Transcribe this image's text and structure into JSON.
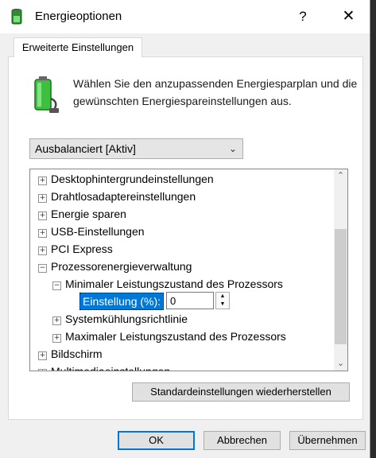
{
  "window": {
    "title": "Energieoptionen",
    "help_glyph": "?",
    "close_glyph": "✕"
  },
  "tab": {
    "label": "Erweiterte Einstellungen"
  },
  "description": "Wählen Sie den anzupassenden Energiesparplan und die gewünschten Energiespareinstellungen aus.",
  "plan_select": {
    "value": "Ausbalanciert [Aktiv]"
  },
  "tree": {
    "items": [
      {
        "label": "Desktophintergrundeinstellungen",
        "expander": "+"
      },
      {
        "label": "Drahtlosadaptereinstellungen",
        "expander": "+"
      },
      {
        "label": "Energie sparen",
        "expander": "+"
      },
      {
        "label": "USB-Einstellungen",
        "expander": "+"
      },
      {
        "label": "PCI Express",
        "expander": "+"
      },
      {
        "label": "Prozessorenergieverwaltung",
        "expander": "−"
      },
      {
        "label": "Minimaler Leistungszustand des Prozessors",
        "expander": "−"
      },
      {
        "label": "Systemkühlungsrichtlinie",
        "expander": "+"
      },
      {
        "label": "Maximaler Leistungszustand des Prozessors",
        "expander": "+"
      },
      {
        "label": "Bildschirm",
        "expander": "+"
      },
      {
        "label": "Multimediaeinstellungen",
        "expander": "+"
      }
    ],
    "setting": {
      "label": "Einstellung (%):",
      "value": "0"
    }
  },
  "buttons": {
    "restore": "Standardeinstellungen wiederherstellen",
    "ok": "OK",
    "cancel": "Abbrechen",
    "apply": "Übernehmen"
  },
  "colors": {
    "selection": "#0078d7",
    "battery_green": "#3fbf3f"
  }
}
